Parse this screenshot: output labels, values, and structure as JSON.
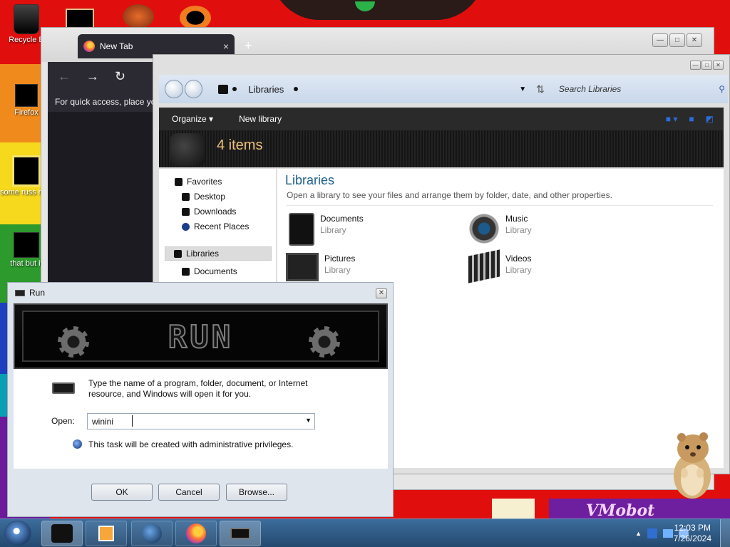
{
  "desktop": {
    "icons": [
      {
        "label": "Recycle B"
      },
      {
        "label": "Firefox"
      },
      {
        "label": "some russ ran a ra"
      },
      {
        "label": "that but it"
      }
    ],
    "banner_text": "VMobot"
  },
  "firefox": {
    "tab_title": "New Tab",
    "tab_close": "×",
    "new_tab": "+",
    "bookmarks_hint": "For quick access, place yo"
  },
  "libraries": {
    "breadcrumb": "Libraries",
    "search_placeholder": "Search Libraries",
    "commands": {
      "organize": "Organize",
      "new_library": "New library"
    },
    "item_count": "4 items",
    "nav": {
      "favorites": "Favorites",
      "desktop": "Desktop",
      "downloads": "Downloads",
      "recent": "Recent Places",
      "libraries": "Libraries",
      "documents": "Documents"
    },
    "heading": "Libraries",
    "subheading": "Open a library to see your files and arrange them by folder, date, and other properties.",
    "items": [
      {
        "name": "Documents",
        "type": "Library"
      },
      {
        "name": "Music",
        "type": "Library"
      },
      {
        "name": "Pictures",
        "type": "Library"
      },
      {
        "name": "Videos",
        "type": "Library"
      }
    ]
  },
  "run": {
    "title": "Run",
    "banner": "RUN",
    "description": "Type the name of a program, folder, document, or Internet resource, and Windows will open it for you.",
    "open_label": "Open:",
    "open_value": "winini",
    "admin_note": "This task will be created with administrative privileges.",
    "buttons": {
      "ok": "OK",
      "cancel": "Cancel",
      "browse": "Browse..."
    }
  },
  "taskbar": {
    "time": "12:03 PM",
    "date": "7/26/2024"
  }
}
